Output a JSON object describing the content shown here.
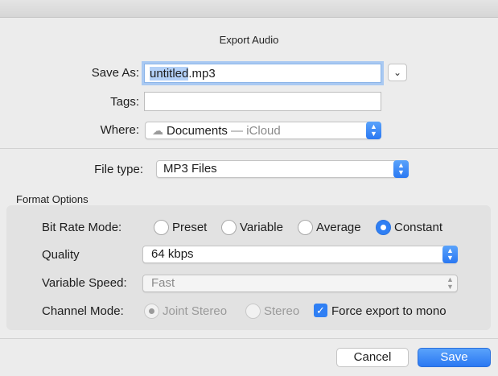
{
  "dialog": {
    "title": "Export Audio"
  },
  "save_as": {
    "label": "Save As:",
    "filename_selected": "untitled",
    "filename_ext": ".mp3",
    "expand_icon": "chevron-down-icon"
  },
  "tags": {
    "label": "Tags:",
    "value": ""
  },
  "where": {
    "label": "Where:",
    "folder": "Documents",
    "location": " — iCloud",
    "icon": "cloud-icon"
  },
  "file_type": {
    "label": "File type:",
    "value": "MP3 Files"
  },
  "format_options": {
    "title": "Format Options",
    "bit_rate_mode": {
      "label": "Bit Rate Mode:",
      "options": [
        "Preset",
        "Variable",
        "Average",
        "Constant"
      ],
      "selected": "Constant"
    },
    "quality": {
      "label": "Quality",
      "value": "64 kbps"
    },
    "variable_speed": {
      "label": "Variable Speed:",
      "value": "Fast"
    },
    "channel_mode": {
      "label": "Channel Mode:",
      "options": [
        "Joint Stereo",
        "Stereo"
      ],
      "selected": "Joint Stereo",
      "force_mono_label": "Force export to mono",
      "force_mono_checked": true
    }
  },
  "buttons": {
    "cancel": "Cancel",
    "save": "Save"
  },
  "colors": {
    "accent": "#2f7ff4",
    "selection": "#b3d0f7",
    "background": "#ececec",
    "panel": "#e2e2e2"
  }
}
